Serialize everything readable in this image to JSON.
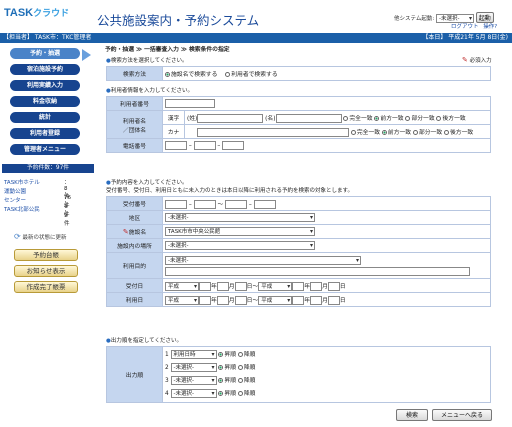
{
  "header": {
    "logo_main": "TASK",
    "logo_sub": "クラウド",
    "title": "公共施設案内・予約システム",
    "other_system_label": "他システム起動:",
    "other_system_value": "-未選択-",
    "launch_btn": "起動",
    "logout": "ログアウト",
    "help": "操作?"
  },
  "topbar": {
    "left": "【担当者】 TASK市：TKC管理者",
    "right": "【本日】 平成21年 5月 8日(金)"
  },
  "sidebar": {
    "items": [
      "予約・抽選",
      "宿泊施設予約",
      "利用実績入力",
      "料金収納",
      "統計",
      "利用者登録",
      "管理者メニュー"
    ],
    "count_title": "予約件数：97件",
    "counts": [
      {
        "name": "TASK市ホテル",
        "n": "：8件"
      },
      {
        "name": "運動公園",
        "n": "：76件"
      },
      {
        "name": "センター",
        "n": "：4件"
      },
      {
        "name": "TASK北部公民",
        "n": "：9件"
      }
    ],
    "refresh": "最新の状態に更新",
    "buttons": [
      "予約台帳",
      "お知らせ表示",
      "作成完了帳票"
    ]
  },
  "breadcrumb": "予約・抽選 ≫ 一括審査入力 ≫ 検索条件の指定",
  "required_note": "必須入力",
  "sec1": {
    "title": "検索方法を選択してください。",
    "label": "検索方法",
    "opt1": "施設名で検索する",
    "opt2": "利用者で検索する"
  },
  "sec2": {
    "title": "利用者情報を入力してください。",
    "user_no": "利用者番号",
    "name_label1": "利用者名",
    "name_label2": "／団体名",
    "kanji": "漢字",
    "kana": "カナ",
    "sei": "(姓)",
    "mei": "(名)",
    "phone": "電話番号",
    "match": [
      "完全一致",
      "前方一致",
      "部分一致",
      "後方一致"
    ]
  },
  "sec3": {
    "title": "予約内容を入力してください。",
    "note": "受付番号、受付日、利用日ともに未入力のときは本日以降に利用される予約を検索の対象とします。",
    "rows": {
      "uketsuke": "受付番号",
      "chiku": "地区",
      "shisetsu": "施設名",
      "basho": "施設内の場所",
      "mokuteki": "利用目的",
      "uketsukebi": "受付日",
      "riyoubi": "利用日"
    },
    "chiku_value": "-未選択-",
    "shisetsu_value": "TASK市市中央公民館",
    "basho_value": "-未選択-",
    "mokuteki_value": "-未選択-",
    "era": "平成",
    "year": "年",
    "month": "月",
    "day": "日",
    "tilde": "～"
  },
  "sec4": {
    "title": "出力順を指定してください。",
    "label": "出力順",
    "rows": [
      {
        "no": "1",
        "value": "利用日時"
      },
      {
        "no": "2",
        "value": "-未選択-"
      },
      {
        "no": "3",
        "value": "-未選択-"
      },
      {
        "no": "4",
        "value": "-未選択-"
      }
    ],
    "asc": "昇順",
    "desc": "降順"
  },
  "footer": {
    "search": "検索",
    "back": "メニューへ戻る"
  }
}
